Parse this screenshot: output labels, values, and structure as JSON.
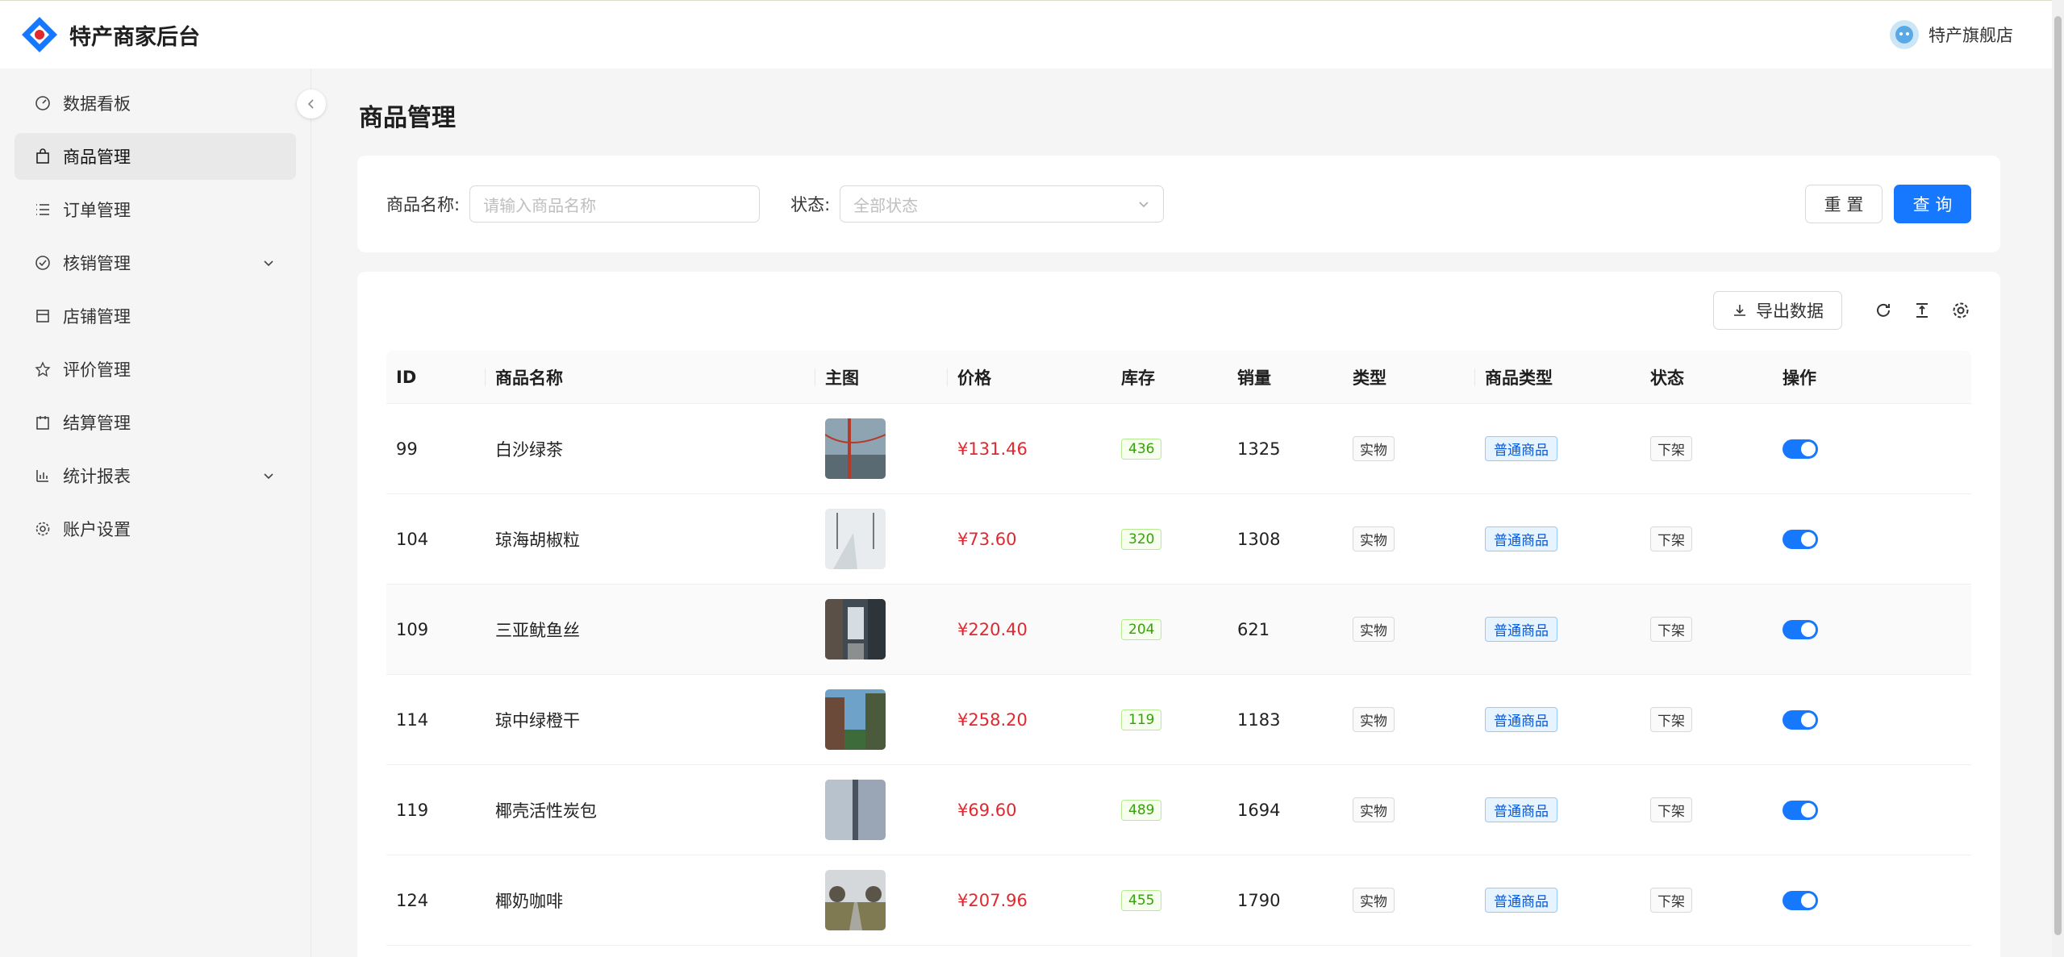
{
  "header": {
    "brand": "特产商家后台",
    "shop_name": "特产旗舰店"
  },
  "sidebar": {
    "items": [
      {
        "label": "数据看板",
        "icon": "dashboard-icon"
      },
      {
        "label": "商品管理",
        "icon": "shopping-bag-icon",
        "active": true
      },
      {
        "label": "订单管理",
        "icon": "list-icon"
      },
      {
        "label": "核销管理",
        "icon": "check-circle-icon",
        "expandable": true
      },
      {
        "label": "店铺管理",
        "icon": "shop-icon"
      },
      {
        "label": "评价管理",
        "icon": "star-icon"
      },
      {
        "label": "结算管理",
        "icon": "calendar-icon"
      },
      {
        "label": "统计报表",
        "icon": "bar-chart-icon",
        "expandable": true
      },
      {
        "label": "账户设置",
        "icon": "gear-icon"
      }
    ]
  },
  "page": {
    "title": "商品管理"
  },
  "filter": {
    "name_label": "商品名称:",
    "name_placeholder": "请输入商品名称",
    "status_label": "状态:",
    "status_placeholder": "全部状态",
    "reset_label": "重 置",
    "query_label": "查 询"
  },
  "toolbar": {
    "export_label": "导出数据"
  },
  "table": {
    "columns": [
      "ID",
      "商品名称",
      "主图",
      "价格",
      "库存",
      "销量",
      "类型",
      "商品类型",
      "状态",
      "操作"
    ],
    "rows": [
      {
        "id": "99",
        "name": "白沙绿茶",
        "price": "¥131.46",
        "stock": "436",
        "sales": "1325",
        "type": "实物",
        "ptype": "普通商品",
        "status": "下架",
        "enabled": true
      },
      {
        "id": "104",
        "name": "琼海胡椒粒",
        "price": "¥73.60",
        "stock": "320",
        "sales": "1308",
        "type": "实物",
        "ptype": "普通商品",
        "status": "下架",
        "enabled": true
      },
      {
        "id": "109",
        "name": "三亚鱿鱼丝",
        "price": "¥220.40",
        "stock": "204",
        "sales": "621",
        "type": "实物",
        "ptype": "普通商品",
        "status": "下架",
        "enabled": true
      },
      {
        "id": "114",
        "name": "琼中绿橙干",
        "price": "¥258.20",
        "stock": "119",
        "sales": "1183",
        "type": "实物",
        "ptype": "普通商品",
        "status": "下架",
        "enabled": true
      },
      {
        "id": "119",
        "name": "椰壳活性炭包",
        "price": "¥69.60",
        "stock": "489",
        "sales": "1694",
        "type": "实物",
        "ptype": "普通商品",
        "status": "下架",
        "enabled": true
      },
      {
        "id": "124",
        "name": "椰奶咖啡",
        "price": "¥207.96",
        "stock": "455",
        "sales": "1790",
        "type": "实物",
        "ptype": "普通商品",
        "status": "下架",
        "enabled": true
      }
    ]
  },
  "colors": {
    "primary": "#1677ff",
    "price": "#e0282e"
  }
}
